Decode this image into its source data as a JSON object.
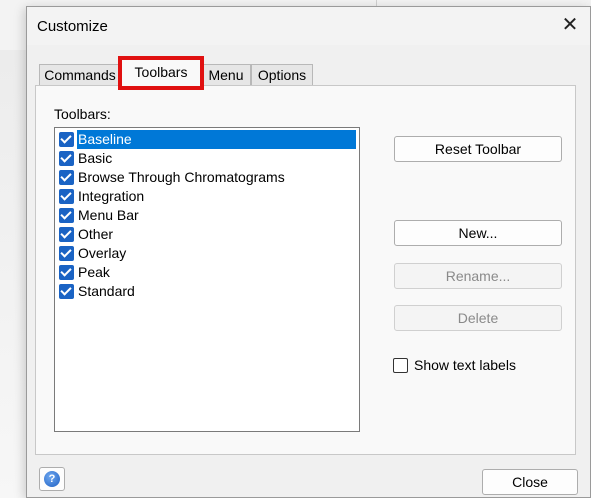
{
  "dialog": {
    "title": "Customize",
    "close_glyph": "✕"
  },
  "tabs": [
    {
      "label": "Commands",
      "active": false
    },
    {
      "label": "Toolbars",
      "active": true
    },
    {
      "label": "Menu",
      "active": false
    },
    {
      "label": "Options",
      "active": false
    }
  ],
  "toolbars_panel": {
    "label": "Toolbars:",
    "items": [
      {
        "label": "Baseline",
        "checked": true,
        "selected": true
      },
      {
        "label": "Basic",
        "checked": true,
        "selected": false
      },
      {
        "label": "Browse Through Chromatograms",
        "checked": true,
        "selected": false
      },
      {
        "label": "Integration",
        "checked": true,
        "selected": false
      },
      {
        "label": "Menu Bar",
        "checked": true,
        "selected": false
      },
      {
        "label": "Other",
        "checked": true,
        "selected": false
      },
      {
        "label": "Overlay",
        "checked": true,
        "selected": false
      },
      {
        "label": "Peak",
        "checked": true,
        "selected": false
      },
      {
        "label": "Standard",
        "checked": true,
        "selected": false
      }
    ],
    "buttons": {
      "reset_toolbar": "Reset Toolbar",
      "new": "New...",
      "rename": "Rename...",
      "delete": "Delete"
    },
    "show_text_labels": {
      "label": "Show text labels",
      "checked": false
    }
  },
  "footer": {
    "help_glyph": "?",
    "close_label": "Close"
  },
  "colors": {
    "selection": "#0078d7",
    "checkbox": "#1a63c4",
    "highlight_outline": "#e01010"
  }
}
